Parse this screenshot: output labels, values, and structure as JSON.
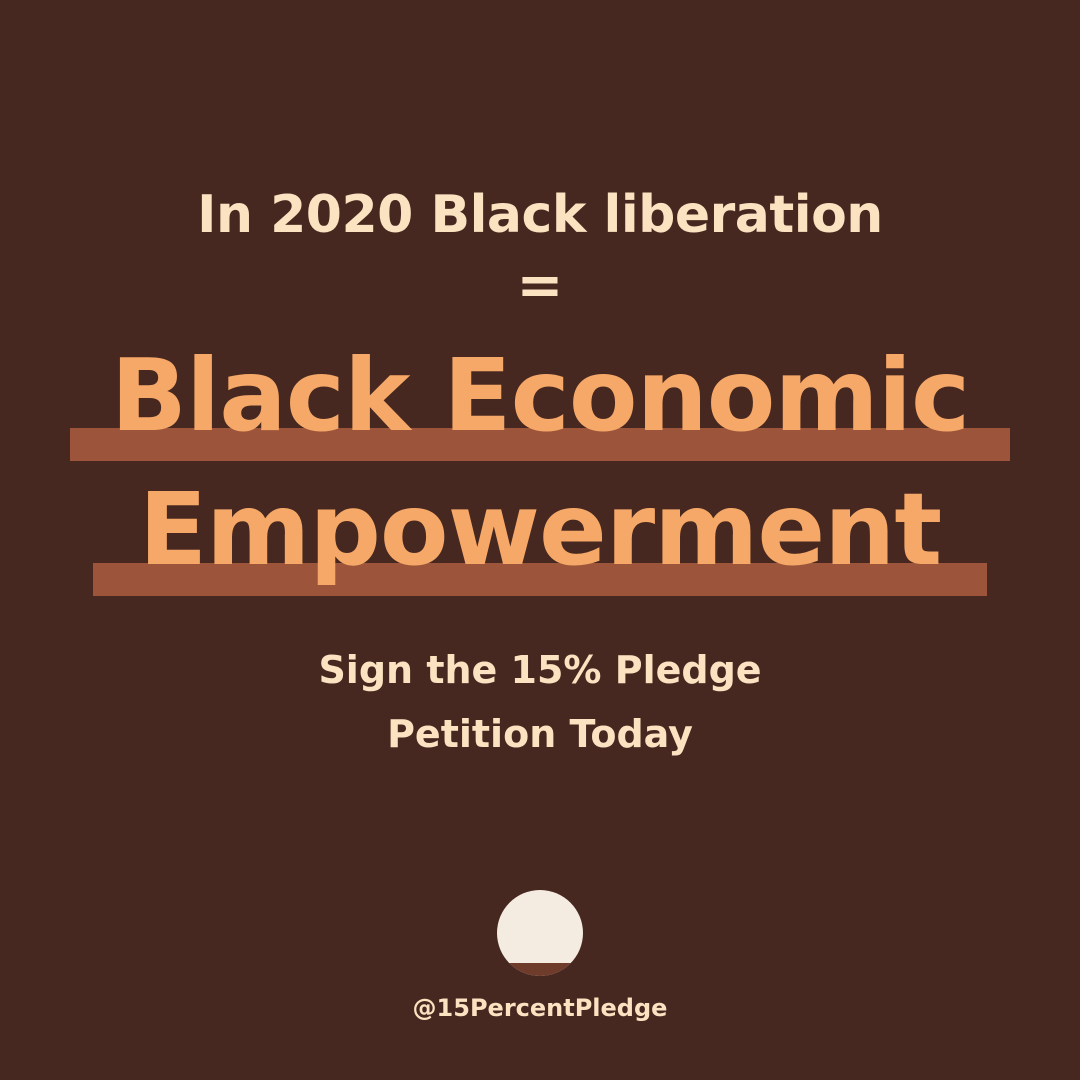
{
  "post": {
    "intro": "In 2020 Black liberation",
    "equals": "=",
    "headline_line1": "Black Economic",
    "headline_line2": "Empowerment",
    "cta_line1": "Sign the 15% Pledge",
    "cta_line2": "Petition Today",
    "handle": "@15PercentPledge",
    "logo_icon": "half-circle-logo-icon"
  },
  "colors": {
    "background": "#472820",
    "cream_text": "#fbe2c0",
    "headline_orange": "#f6a868",
    "highlight_bar": "#9c553a",
    "logo_cream": "#f5ece1",
    "logo_band": "#6f3b2b"
  }
}
